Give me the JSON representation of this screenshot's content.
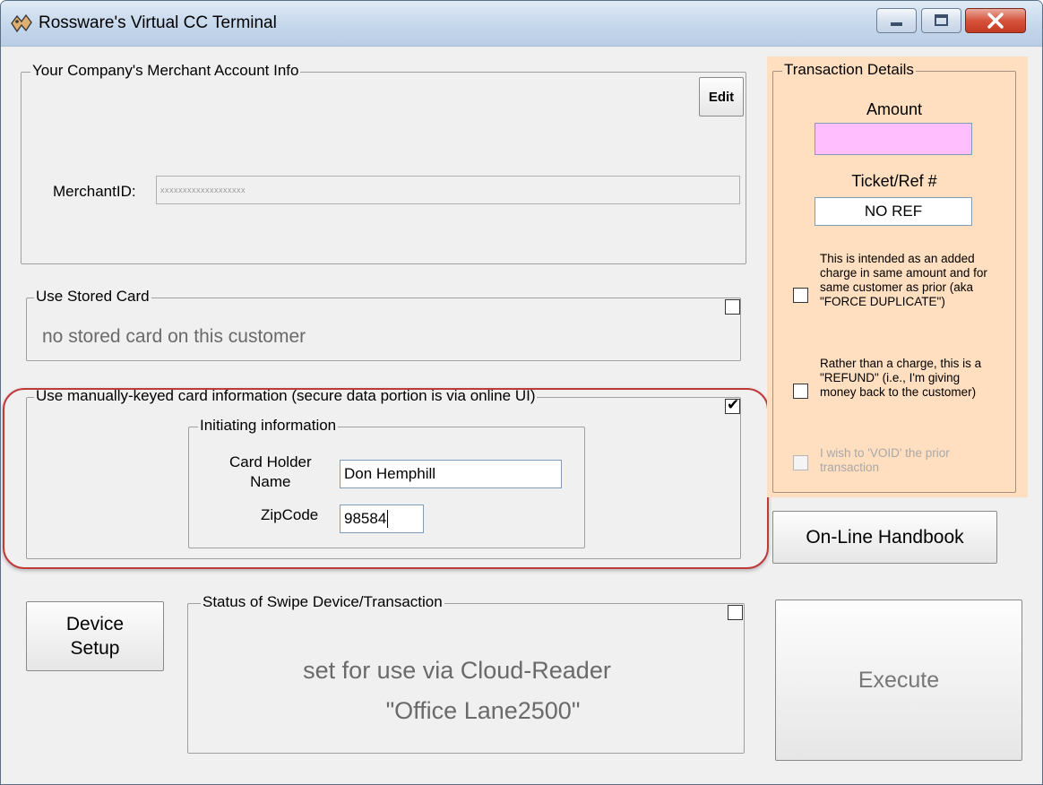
{
  "window": {
    "title": "Rossware's Virtual CC Terminal"
  },
  "merchant": {
    "legend": "Your Company's Merchant Account Info",
    "edit_label": "Edit",
    "merchant_id_label": "MerchantID:",
    "merchant_id_value": "xxxxxxxxxxxxxxxxxxx"
  },
  "stored_card": {
    "legend": "Use Stored Card",
    "message": "no stored card on this customer",
    "checked": false
  },
  "manual": {
    "legend": "Use manually-keyed card information (secure data portion is via online UI)",
    "checked": true,
    "initiating_legend": "Initiating information",
    "card_holder_label_line1": "Card Holder",
    "card_holder_label_line2": "Name",
    "card_holder_value": "Don Hemphill",
    "zip_label": "ZipCode",
    "zip_value": "98584"
  },
  "device": {
    "setup_line1": "Device",
    "setup_line2": "Setup"
  },
  "status": {
    "legend": "Status of Swipe Device/Transaction",
    "line1": "set for use via Cloud-Reader",
    "line2": "\"Office Lane2500\"",
    "checked": false
  },
  "transaction": {
    "legend": "Transaction Details",
    "amount_label": "Amount",
    "amount_value": "",
    "ticket_label": "Ticket/Ref #",
    "ticket_value": "NO REF",
    "duplicate_text": "This is intended as an added charge in same amount and for same customer as prior (aka \"FORCE DUPLICATE\")",
    "refund_text": "Rather than a charge, this is a \"REFUND\" (i.e., I'm giving money back to the customer)",
    "void_text": "I wish to 'VOID' the prior transaction"
  },
  "buttons": {
    "handbook": "On-Line Handbook",
    "execute": "Execute"
  },
  "colors": {
    "transaction_panel_bg": "#ffdfc0",
    "amount_bg": "#ffbfff",
    "highlight": "#c0393b"
  }
}
